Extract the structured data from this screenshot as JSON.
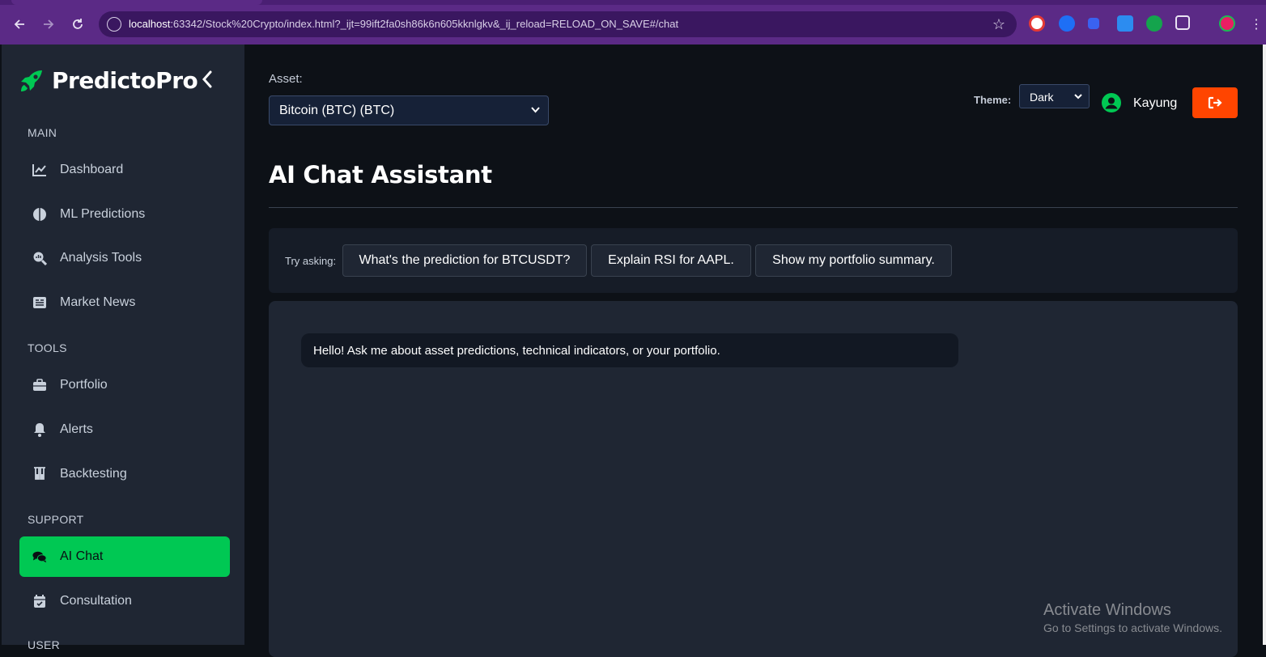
{
  "browser": {
    "url_host": "localhost",
    "url_rest": ":63342/Stock%20Crypto/index.html?_ijt=99ift2fa0sh86k6n605kknlgkv&_ij_reload=RELOAD_ON_SAVE#/chat",
    "icons": [
      "back-icon",
      "forward-icon",
      "reload-icon",
      "site-info-icon",
      "bookmark-star-icon",
      "extension-icons",
      "puzzle-icon",
      "profile-icon",
      "menu-icon"
    ]
  },
  "sidebar": {
    "brand": "PredictoPro",
    "sections": {
      "main": "MAIN",
      "tools": "TOOLS",
      "support": "SUPPORT",
      "user": "USER"
    },
    "items": [
      {
        "label": "Dashboard",
        "icon": "chart-line-icon"
      },
      {
        "label": "ML Predictions",
        "icon": "brain-icon"
      },
      {
        "label": "Analysis Tools",
        "icon": "search-chart-icon"
      },
      {
        "label": "Market News",
        "icon": "newspaper-icon"
      },
      {
        "label": "Portfolio",
        "icon": "briefcase-icon"
      },
      {
        "label": "Alerts",
        "icon": "bell-icon"
      },
      {
        "label": "Backtesting",
        "icon": "flask-icon"
      },
      {
        "label": "AI Chat",
        "icon": "comments-icon",
        "active": true
      },
      {
        "label": "Consultation",
        "icon": "calendar-check-icon"
      }
    ]
  },
  "header": {
    "asset_label": "Asset:",
    "asset_value": "Bitcoin (BTC) (BTC)",
    "theme_label": "Theme:",
    "theme_value": "Dark",
    "user_name": "Kayung"
  },
  "main": {
    "title": "AI Chat Assistant",
    "try_label": "Try asking:",
    "suggestions": [
      "What's the prediction for BTCUSDT?",
      "Explain RSI for AAPL.",
      "Show my portfolio summary."
    ],
    "messages": [
      {
        "role": "bot",
        "text": "Hello! Ask me about asset predictions, technical indicators, or your portfolio."
      }
    ]
  },
  "watermark": {
    "line1": "Activate Windows",
    "line2": "Go to Settings to activate Windows."
  },
  "colors": {
    "accent": "#00c853",
    "danger": "#ff4500",
    "browser_frame": "#5b2a86"
  }
}
